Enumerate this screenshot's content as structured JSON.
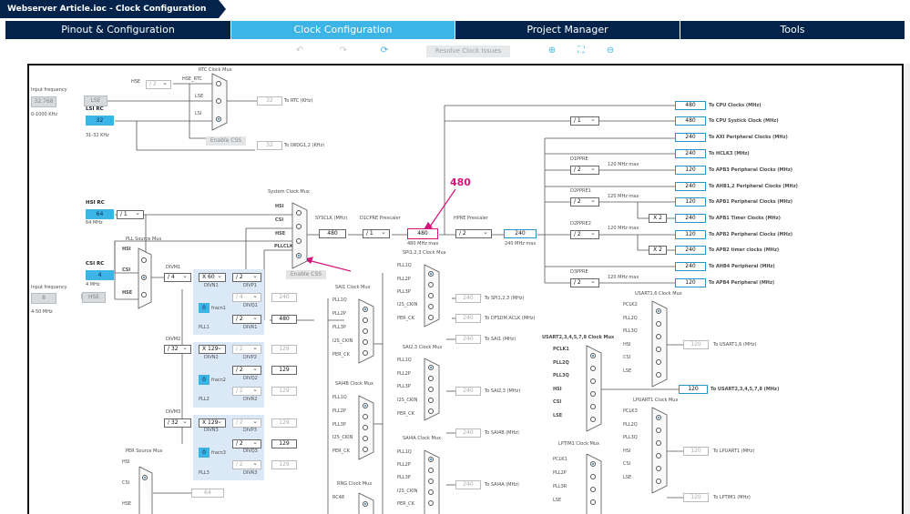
{
  "breadcrumb": {
    "title": "Webserver Article.ioc - Clock Configuration"
  },
  "tabs": [
    "Pinout & Configuration",
    "Clock Configuration",
    "Project Manager",
    "Tools"
  ],
  "toolbar": {
    "resolve": "Resolve Clock Issues",
    "icons": [
      "undo-icon",
      "redo-icon",
      "refresh-icon",
      "zoom-in-icon",
      "fit-icon",
      "zoom-out-icon"
    ]
  },
  "colors": {
    "accent": "#3cb4e6",
    "navy": "#03234b",
    "highlight": "#d4147a"
  },
  "annotation": {
    "value": "480"
  },
  "left_inputs": {
    "input_freq_label": "Input frequency",
    "lse_freq": "32.768",
    "lse_range": "0-1000 KHz",
    "lse": "LSE",
    "lsi_rc": "LSI RC",
    "lsi_val": "32",
    "lsi_khz": "31-32 KHz",
    "hsi_rc": "HSI RC",
    "hsi_val": "64",
    "hsi_mhz": "64 MHz",
    "csi_rc": "CSI RC",
    "csi_val": "4",
    "csi_mhz": "4 MHz",
    "input_freq_label2": "Input frequency",
    "hse_freq": "8",
    "hse_range": "4-50 MHz",
    "hse": "HSE"
  },
  "rtc": {
    "title": "RTC Clock Mux",
    "hse": "HSE",
    "div": "/ 2",
    "hse_rtc": "HSE_RTC",
    "lse": "LSE",
    "lsi": "LSI",
    "out": "32",
    "out_label": "To RTC (KHz)",
    "enable_css": "Enable CSS",
    "iwdg": "32",
    "iwdg_label": "To IWDG1,2 (KHz)"
  },
  "sysmux": {
    "title": "System Clock Mux",
    "inputs": [
      "HSI",
      "CSI",
      "HSE",
      "PLLCLK"
    ],
    "enable_css": "Enable CSS",
    "sysclk_label": "SYSCLK (MHz)",
    "sysclk": "480",
    "d1cpre_label": "D1CPRE Prescaler",
    "d1cpre": "/ 1",
    "d1cpre_out": "480",
    "d1cpre_max": "480 MHz max",
    "hpre_label": "HPRE Prescaler",
    "hpre": "/ 2",
    "hpre_out": "240",
    "hpre_max": "240 MHz max"
  },
  "pll": {
    "source_title": "PLL Source Mux",
    "sources": [
      "HSI",
      "CSI",
      "HSE"
    ],
    "hsi_div": "/ 1",
    "pll1": {
      "divm_label": "DIVM1",
      "divm": "/ 4",
      "divn": "X 60",
      "divn_label": "DIVN1",
      "divp": "/ 2",
      "divp_label": "DIVP1",
      "frac": "0",
      "frac_label": "fracn1",
      "divq": "/ 4",
      "divq_label": "DIVQ1",
      "divr": "/ 2",
      "divr_label": "DIVR1",
      "name": "PLL1",
      "q_out": "240",
      "r_out": "480"
    },
    "pll2": {
      "divm_label": "DIVM2",
      "divm": "/ 32",
      "divn": "X 129",
      "divn_label": "DIVN2",
      "divp": "/ 2",
      "divp_label": "DIVP2",
      "frac": "0",
      "frac_label": "fracn2",
      "divq": "/ 2",
      "divq_label": "DIVQ2",
      "divr": "/ 2",
      "divr_label": "DIVR2",
      "name": "PLL2",
      "p_out": "129",
      "q_out": "129",
      "r_out": "129"
    },
    "pll3": {
      "divm_label": "DIVM3",
      "divm": "/ 32",
      "divn": "X 129",
      "divn_label": "DIVN3",
      "divp": "/ 2",
      "divp_label": "DIVP3",
      "frac": "0",
      "frac_label": "fracn3",
      "divq": "/ 2",
      "divq_label": "DIVQ3",
      "divr": "/ 2",
      "divr_label": "DIVR3",
      "name": "PLL3",
      "p_out": "129",
      "q_out": "129",
      "r_out": "129"
    }
  },
  "per": {
    "title": "PER Source Mux",
    "inputs": [
      "HSI",
      "CSI",
      "HSE"
    ],
    "out": "64"
  },
  "outputs": {
    "cpu": {
      "val": "480",
      "label": "To CPU Clocks (MHz)"
    },
    "systick_div": "/ 1",
    "systick": {
      "val": "480",
      "label": "To CPU Systick Clock (MHz)"
    },
    "axi": {
      "val": "240",
      "label": "To AXI Peripheral Clocks (MHz)"
    },
    "hclk3": {
      "val": "240",
      "label": "To HCLK3 (MHz)"
    },
    "d1ppre_label": "D1PPRE",
    "d1ppre": "/ 2",
    "d1ppre_max": "120 MHz max",
    "apb3": {
      "val": "120",
      "label": "To APB3 Peripheral Clocks (MHz)"
    },
    "ahb12": {
      "val": "240",
      "label": "To AHB1,2 Peripheral Clocks (MHz)"
    },
    "d2ppre1_label": "D2PPRE1",
    "d2ppre1": "/ 2",
    "d2ppre1_max": "120 MHz max",
    "apb1": {
      "val": "120",
      "label": "To APB1 Peripheral Clocks (MHz)"
    },
    "x2a": "X 2",
    "apb1t": {
      "val": "240",
      "label": "To APB1 Timer Clocks (MHz)"
    },
    "d2ppre2_label": "D2PPRE2",
    "d2ppre2": "/ 2",
    "d2ppre2_max": "120 MHz max",
    "apb2": {
      "val": "120",
      "label": "To APB2 Peripheral Clocks (MHz)"
    },
    "x2b": "X 2",
    "apb2t": {
      "val": "240",
      "label": "To APB2 timer clocks (MHz)"
    },
    "ahb4": {
      "val": "240",
      "label": "To AHB4 Peripheral (MHz)"
    },
    "d3ppre_label": "D3PPRE",
    "d3ppre": "/ 2",
    "d3ppre_max": "120 MHz max",
    "apb4": {
      "val": "120",
      "label": "To APB4 Peripheral (MHz)"
    }
  },
  "spi123": {
    "title": "SPI1,2,3 Clock Mux",
    "inputs": [
      "PLL1Q",
      "PLL2P",
      "PLL3P",
      "I2S_CKIN",
      "PER_CK"
    ],
    "out1": "240",
    "label1": "To SPI1,2,3 (MHz)",
    "out2": "240",
    "label2": "To DFSDM ACLK (MHz)"
  },
  "sai1": {
    "title": "SAI1 Clock Mux",
    "inputs": [
      "PLL1Q",
      "PLL2P",
      "PLL3P",
      "I2S_CKIN",
      "PER_CK"
    ],
    "out": "240",
    "label": "To SAI1 (MHz)"
  },
  "sai23": {
    "title": "SAI2,3 Clock Mux",
    "inputs": [
      "PLL1Q",
      "PLL2P",
      "PLL3P",
      "I2S_CKIN",
      "PER_CK"
    ],
    "out": "240",
    "label": "To SAI2,3 (MHz)"
  },
  "sai4b": {
    "title": "SAI4B Clock Mux",
    "inputs": [
      "PLL1Q",
      "PLL2P",
      "PLL3P",
      "I2S_CKIN",
      "PER_CK"
    ],
    "out": "240",
    "label": "To SAI4B (MHz)"
  },
  "sai4a": {
    "title": "SAI4A Clock Mux",
    "inputs": [
      "PLL1Q",
      "PLL2P",
      "PLL3P",
      "I2S_CKIN",
      "PER_CK"
    ],
    "out": "240",
    "label": "To SAI4A (MHz)"
  },
  "rng": {
    "title": "RNG Clock Mux",
    "inputs": [
      "RC48"
    ]
  },
  "usart16": {
    "title": "USART1,6 Clock Mux",
    "inputs": [
      "PCLK2",
      "PLL2Q",
      "PLL3Q",
      "HSI",
      "CSI",
      "LSE"
    ],
    "out": "120",
    "label": "To USART1,6 (MHz)"
  },
  "usart2": {
    "title": "USART2,3,4,5,7,8 Clock Mux",
    "inputs": [
      "PCLK1",
      "PLL2Q",
      "PLL3Q",
      "HSI",
      "CSI",
      "LSE"
    ],
    "out": "120",
    "label": "To USART2,3,4,5,7,8 (MHz)"
  },
  "lpuart1": {
    "title": "LPUART1 Clock Mux",
    "inputs": [
      "PCLK3",
      "PLL2Q",
      "PLL3Q",
      "HSI",
      "CSI",
      "LSE"
    ],
    "out": "120",
    "label": "To LPUART1 (MHz)"
  },
  "lptim1": {
    "title": "LPTIM1 Clock Mux",
    "inputs": [
      "PCLK1",
      "PLL2P",
      "PLL3R",
      "LSE"
    ],
    "out": "120",
    "label": "To LPTIM1 (MHz)"
  }
}
